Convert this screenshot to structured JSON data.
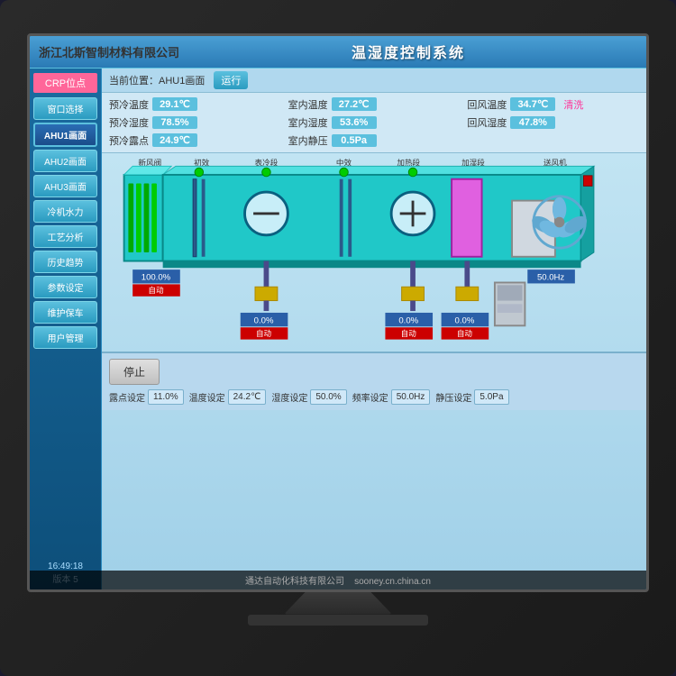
{
  "company": {
    "name": "浙江北斯智制材料有限公司",
    "bottom_text": "通达自动化科技有限公司",
    "website": "sooney.cn.china.cn"
  },
  "system": {
    "title": "温湿度控制系统",
    "status": "运行",
    "location_label": "当前位置：AHU1画面"
  },
  "sidebar": {
    "section_title": "CRP位点",
    "items": [
      {
        "label": "窗口选择"
      },
      {
        "label": "AHU1画面",
        "active": true
      },
      {
        "label": "AHU2画面"
      },
      {
        "label": "AHU3画面"
      },
      {
        "label": "冷机水力"
      },
      {
        "label": "工艺分析"
      },
      {
        "label": "历史趋势"
      },
      {
        "label": "参数设定"
      },
      {
        "label": "维护保车"
      },
      {
        "label": "用户管理"
      }
    ],
    "time": "16:49:18",
    "version": "版本 5"
  },
  "params": {
    "row1": [
      {
        "label": "预冷温度",
        "value": "29.1℃"
      },
      {
        "label": "室内温度",
        "value": "27.2℃"
      },
      {
        "label": "回风温度",
        "value": "34.7℃",
        "extra": "清洗"
      }
    ],
    "row2": [
      {
        "label": "预冷湿度",
        "value": "78.5%"
      },
      {
        "label": "室内湿度",
        "value": "53.6%"
      },
      {
        "label": "回风湿度",
        "value": "47.8%"
      }
    ],
    "row3": [
      {
        "label": "预冷露点",
        "value": "24.9℃"
      },
      {
        "label": "室内静压",
        "value": "0.5Pa"
      },
      {
        "label": "",
        "value": ""
      }
    ]
  },
  "diagram": {
    "headers": [
      "新风阀",
      "初效",
      "表冷段",
      "中效",
      "加热段",
      "加湿段",
      "送风机"
    ],
    "components": {
      "fresh_air_valve": "新风阀",
      "pre_filter": "初效过滤",
      "cooling_coil": "表冷段",
      "mid_filter": "中效",
      "heating": "加热段",
      "humidifier": "加湿段",
      "supply_fan": "送风机"
    },
    "values": [
      {
        "pos": "left1",
        "val": "100.0%",
        "sub": "自动"
      },
      {
        "pos": "mid1",
        "val": "0.0%",
        "sub": "自动"
      },
      {
        "pos": "mid2",
        "val": "0.0%",
        "sub": "自动"
      },
      {
        "pos": "mid3",
        "val": "0.0%",
        "sub": "自动"
      },
      {
        "pos": "right1",
        "val": "50.0Hz"
      }
    ]
  },
  "bottom": {
    "stop_label": "停止",
    "settings": [
      {
        "label": "露点设定",
        "value": "11.0%"
      },
      {
        "label": "温度设定",
        "value": "24.2℃"
      },
      {
        "label": "湿度设定",
        "value": "50.0%"
      },
      {
        "label": "频率设定",
        "value": "50.0Hz"
      },
      {
        "label": "静压设定",
        "value": "5.0Pa"
      }
    ]
  },
  "colors": {
    "accent_blue": "#2a7ab5",
    "duct_cyan": "#20c8c8",
    "active_btn": "#1a4d8a",
    "sidebar_bg": "#1a6ba0",
    "header_bg": "#4a9fd4"
  }
}
